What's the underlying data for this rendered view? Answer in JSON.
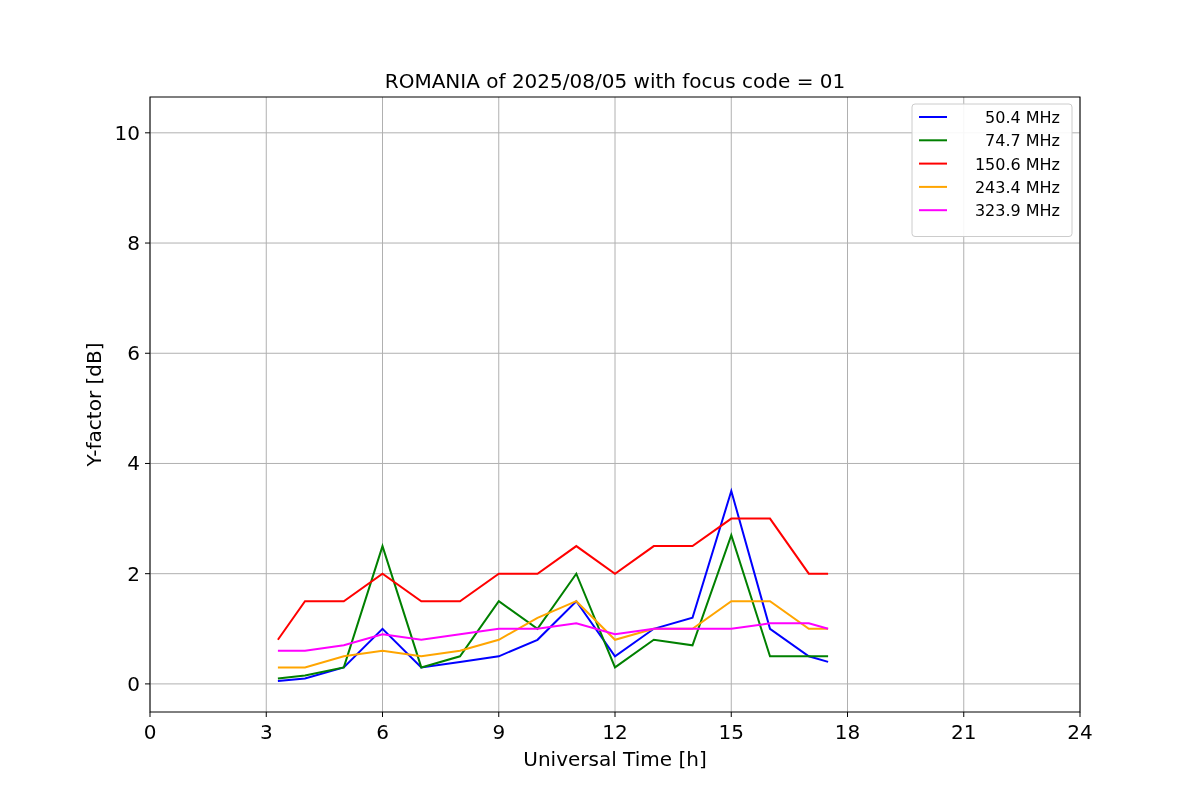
{
  "chart_data": {
    "type": "line",
    "title": "ROMANIA of 2025/08/05 with focus code = 01",
    "xlabel": "Universal Time [h]",
    "ylabel": "Y-factor [dB]",
    "x": [
      3.3,
      4,
      5,
      6,
      7,
      8,
      9,
      10,
      11,
      12,
      13,
      14,
      15,
      16,
      17,
      17.5
    ],
    "series": [
      {
        "name": "50.4 MHz",
        "color": "#0000ff",
        "values": [
          0.05,
          0.1,
          0.3,
          1.0,
          0.3,
          0.4,
          0.5,
          0.8,
          1.5,
          0.5,
          1.0,
          1.2,
          3.5,
          1.0,
          0.5,
          0.4
        ]
      },
      {
        "name": "74.7 MHz",
        "color": "#008000",
        "values": [
          0.1,
          0.15,
          0.3,
          2.5,
          0.3,
          0.5,
          1.5,
          1.0,
          2.0,
          0.3,
          0.8,
          0.7,
          2.7,
          0.5,
          0.5,
          0.5
        ]
      },
      {
        "name": "150.6 MHz",
        "color": "#ff0000",
        "values": [
          0.8,
          1.5,
          1.5,
          2.0,
          1.5,
          1.5,
          2.0,
          2.0,
          2.5,
          2.0,
          2.5,
          2.5,
          3.0,
          3.0,
          2.0,
          2.0
        ]
      },
      {
        "name": "243.4 MHz",
        "color": "#ffa500",
        "values": [
          0.3,
          0.3,
          0.5,
          0.6,
          0.5,
          0.6,
          0.8,
          1.2,
          1.5,
          0.8,
          1.0,
          1.0,
          1.5,
          1.5,
          1.0,
          1.0
        ]
      },
      {
        "name": "323.9 MHz",
        "color": "#ff00ff",
        "values": [
          0.6,
          0.6,
          0.7,
          0.9,
          0.8,
          0.9,
          1.0,
          1.0,
          1.1,
          0.9,
          1.0,
          1.0,
          1.0,
          1.1,
          1.1,
          1.0
        ]
      }
    ],
    "xlim": [
      0,
      24
    ],
    "ylim": [
      -0.51,
      10.65
    ],
    "xticks": [
      0,
      3,
      6,
      9,
      12,
      15,
      18,
      21,
      24
    ],
    "yticks": [
      0,
      2,
      4,
      6,
      8,
      10
    ],
    "grid": true,
    "legend": true
  }
}
